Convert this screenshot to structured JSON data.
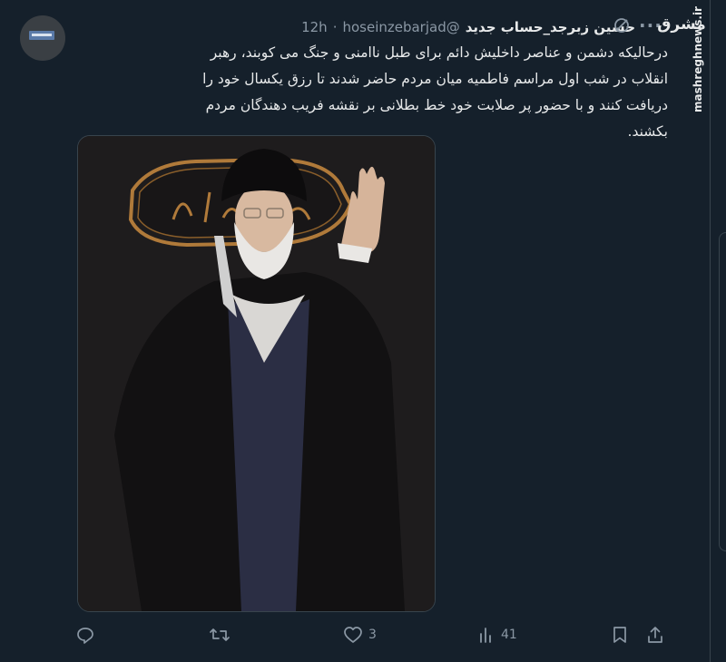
{
  "tweet": {
    "display_name": "حسین زبرجد_حساب جدید",
    "handle": "@hoseinzebarjad",
    "separator": "·",
    "time": "12h",
    "text": "درحالیکه دشمن و عناصر داخلیش دائم برای طبل ناامنی و جنگ می کوبند، رهبر انقلاب در شب اول مراسم فاطمیه میان مردم حاضر شدند تا رزق یکسال خود را دریافت کنند و با حضور پر صلابت خود خط بطلانی بر نقشه فریب دهندگان مردم بکشند.",
    "icons": {
      "more": "more-icon",
      "grok": "grok-icon"
    }
  },
  "actions": {
    "reply": {
      "icon": "reply-icon",
      "count": ""
    },
    "retweet": {
      "icon": "retweet-icon",
      "count": ""
    },
    "like": {
      "icon": "heart-icon",
      "count": "3"
    },
    "views": {
      "icon": "views-icon",
      "count": "41"
    },
    "bookmark": {
      "icon": "bookmark-icon"
    },
    "share": {
      "icon": "share-icon"
    }
  },
  "watermark": {
    "logo": "مشرق",
    "url": "mashreghnews.ir"
  },
  "colors": {
    "background": "#15202b",
    "text": "#e7e9ea",
    "muted": "#8b98a5",
    "border": "#38444d"
  }
}
